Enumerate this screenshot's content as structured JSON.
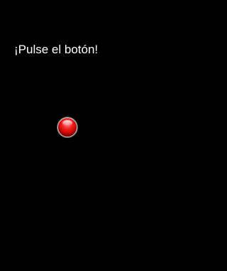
{
  "screen": {
    "prompt_text": "¡Pulse el botón!"
  },
  "button": {
    "icon": "red-circle-button-icon",
    "color": "#e00000"
  },
  "colors": {
    "background": "#000000",
    "text": "#ffffff"
  }
}
